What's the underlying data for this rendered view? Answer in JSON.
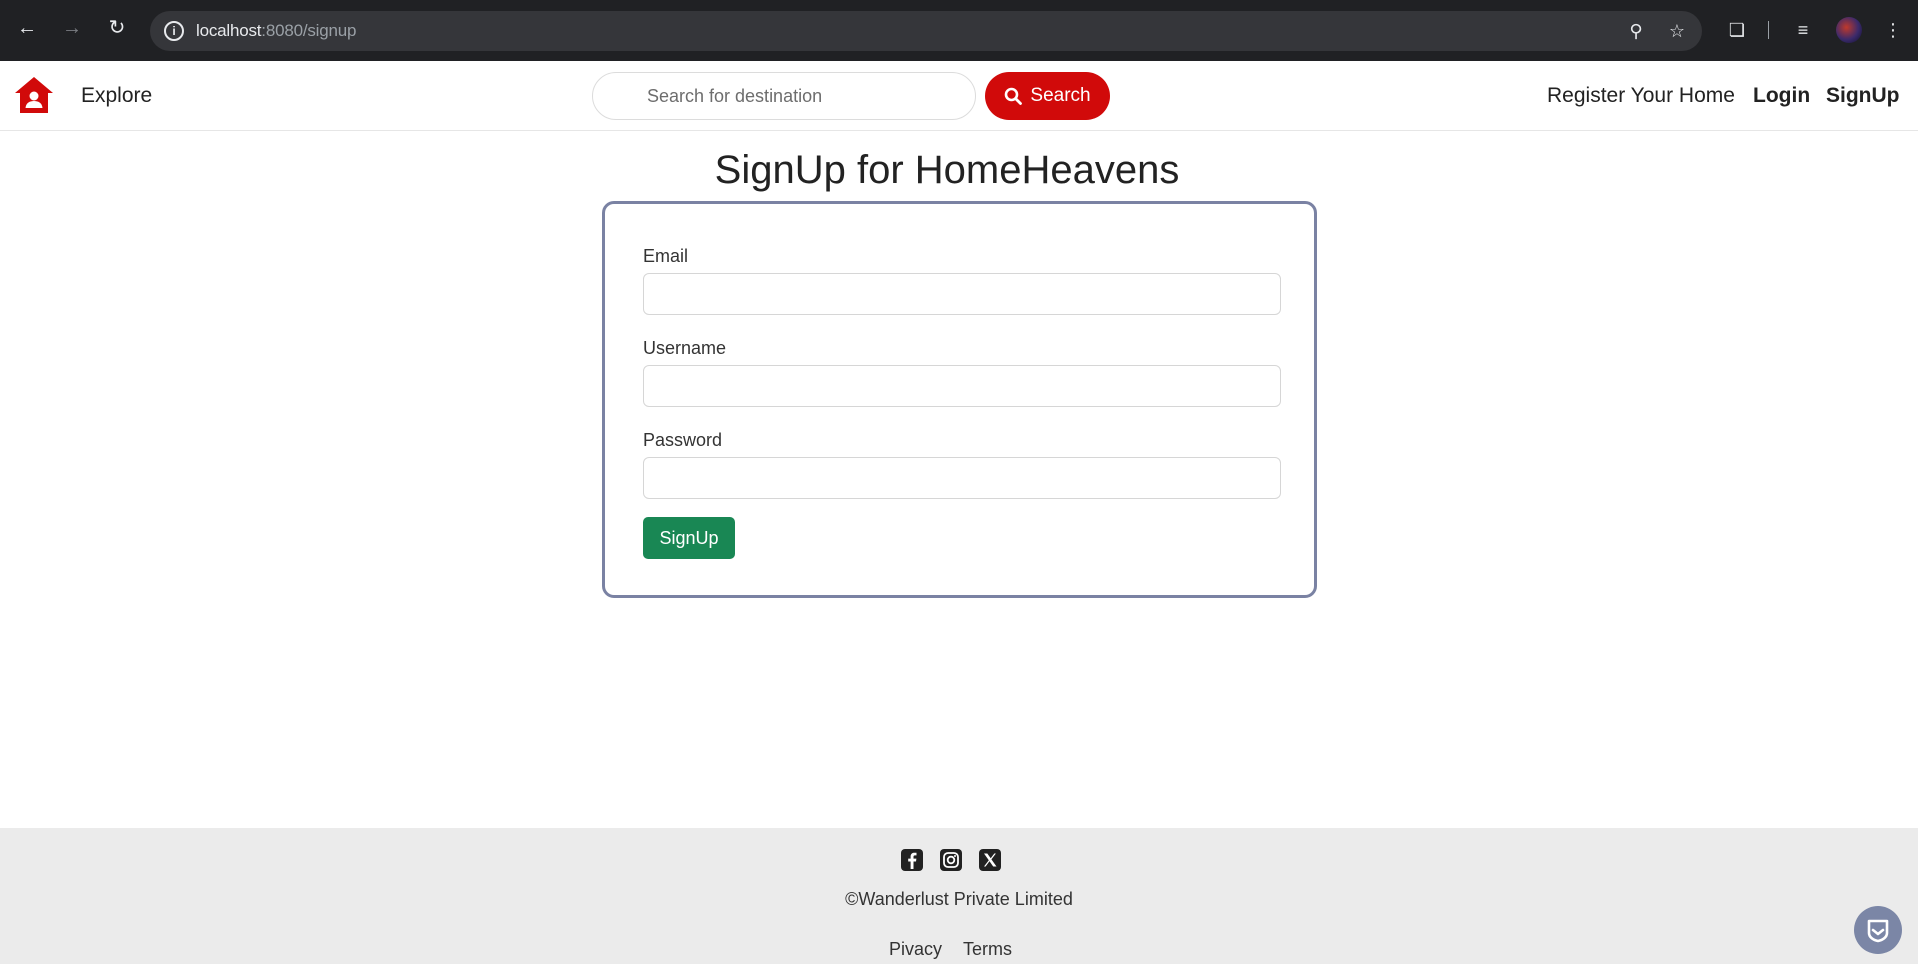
{
  "browser": {
    "url_host": "localhost",
    "url_rest": ":8080/signup"
  },
  "navbar": {
    "explore_label": "Explore",
    "search_placeholder": "Search for destination",
    "search_button_label": "Search",
    "register_label": "Register Your Home",
    "login_label": "Login",
    "signup_label": "SignUp",
    "brand_color": "#d10a0a"
  },
  "page": {
    "title": "SignUp for HomeHeavens"
  },
  "form": {
    "email_label": "Email",
    "email_value": "",
    "username_label": "Username",
    "username_value": "",
    "password_label": "Password",
    "password_value": "",
    "submit_label": "SignUp",
    "submit_color": "#198754"
  },
  "footer": {
    "social_icons": [
      "facebook-icon",
      "instagram-icon",
      "x-twitter-icon"
    ],
    "copyright": "©Wanderlust Private Limited",
    "privacy_label": "Pivacy",
    "terms_label": "Terms"
  }
}
